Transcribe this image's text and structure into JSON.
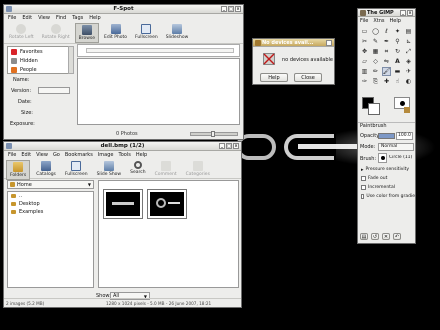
{
  "desktop": {
    "bg": "#000000"
  },
  "fspot": {
    "title": "F-Spot",
    "menu": [
      "File",
      "Edit",
      "View",
      "Find",
      "Tags",
      "Help"
    ],
    "toolbar": [
      {
        "label": "Rotate Left",
        "state": "disabled"
      },
      {
        "label": "Rotate Right",
        "state": "disabled"
      },
      {
        "label": "Browse",
        "state": "active"
      },
      {
        "label": "Edit Photo",
        "state": "normal"
      },
      {
        "label": "Fullscreen",
        "state": "normal"
      },
      {
        "label": "Slideshow",
        "state": "normal"
      }
    ],
    "tags": [
      {
        "label": "Favorites",
        "color": "#d8242a"
      },
      {
        "label": "Hidden",
        "color": "#8c8c8c"
      },
      {
        "label": "People",
        "color": "#e07020"
      }
    ],
    "info_labels": [
      "Name:",
      "Version:",
      "Date:",
      "Size:",
      "Exposure:"
    ],
    "status": "0 Photos"
  },
  "dialog": {
    "title": "No devices avail...",
    "message": "no devices available",
    "help": "Help",
    "close": "Close"
  },
  "gimp": {
    "title": "The GIMP",
    "menu": [
      "File",
      "Xtns",
      "Help"
    ],
    "tool_title": "Paintbrush",
    "opacity_label": "Opacity:",
    "opacity_value": "100.0",
    "mode_label": "Mode:",
    "mode_value": "Normal",
    "brush_label": "Brush:",
    "brush_value": "Circle (11)",
    "options": [
      "Pressure sensitivity",
      "Fade out",
      "Incremental",
      "Use color from gradie"
    ]
  },
  "gthumb": {
    "title": "dell.bmp  (1/2)",
    "menu": [
      "File",
      "Edit",
      "View",
      "Go",
      "Bookmarks",
      "Image",
      "Tools",
      "Help"
    ],
    "toolbar": [
      {
        "label": "Folders",
        "state": "active"
      },
      {
        "label": "Catalogs",
        "state": "normal"
      },
      {
        "label": "Fullscreen",
        "state": "normal"
      },
      {
        "label": "Slide Show",
        "state": "normal"
      },
      {
        "label": "Search",
        "state": "normal"
      },
      {
        "label": "Comment",
        "state": "disabled"
      },
      {
        "label": "Categories",
        "state": "disabled"
      }
    ],
    "location": "Home",
    "folders": [
      "..",
      "Desktop",
      "Examples"
    ],
    "show_label": "Show:",
    "show_value": "All",
    "status_left": "2 images (5.2 MB)",
    "status_right": "1280 x 1024 pixels - 5.0 MB - 26 June 2007, 18:21"
  }
}
